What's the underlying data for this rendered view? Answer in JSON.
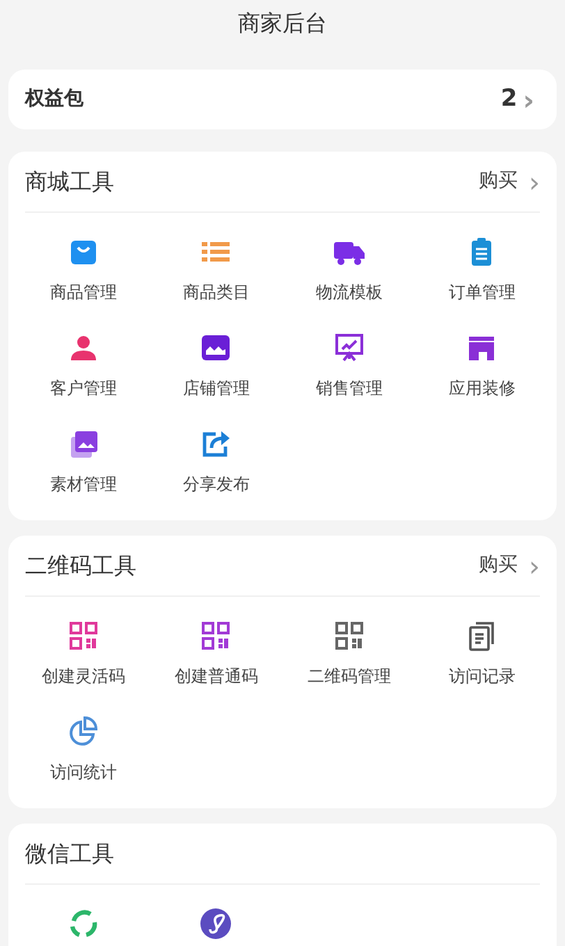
{
  "header": {
    "title": "商家后台"
  },
  "benefits": {
    "label": "权益包",
    "count": "2",
    "chevron": "›"
  },
  "sections": [
    {
      "title": "商城工具",
      "action": "购买",
      "chevron": "›",
      "items": [
        {
          "label": "商品管理",
          "kind": "bag"
        },
        {
          "label": "商品类目",
          "kind": "list"
        },
        {
          "label": "物流模板",
          "kind": "truck"
        },
        {
          "label": "订单管理",
          "kind": "clipboard"
        },
        {
          "label": "客户管理",
          "kind": "person"
        },
        {
          "label": "店铺管理",
          "kind": "shop"
        },
        {
          "label": "销售管理",
          "kind": "chart"
        },
        {
          "label": "应用装修",
          "kind": "store"
        },
        {
          "label": "素材管理",
          "kind": "images"
        },
        {
          "label": "分享发布",
          "kind": "share"
        }
      ]
    },
    {
      "title": "二维码工具",
      "action": "购买",
      "chevron": "›",
      "items": [
        {
          "label": "创建灵活码",
          "kind": "qr-pink"
        },
        {
          "label": "创建普通码",
          "kind": "qr-purple"
        },
        {
          "label": "二维码管理",
          "kind": "qr-gray"
        },
        {
          "label": "访问记录",
          "kind": "pages"
        },
        {
          "label": "访问统计",
          "kind": "pie"
        }
      ]
    },
    {
      "title": "微信工具",
      "items": [
        {
          "kind": "recycle"
        },
        {
          "kind": "miniapp"
        }
      ]
    }
  ]
}
